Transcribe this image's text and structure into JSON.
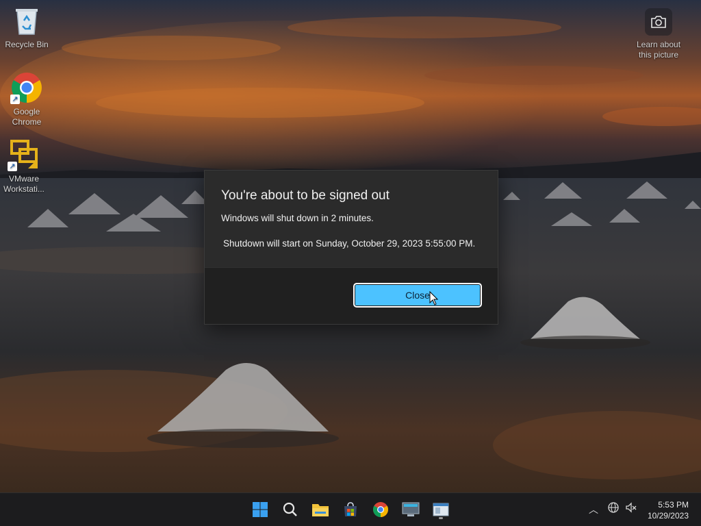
{
  "desktop": {
    "icons": [
      {
        "label": "Recycle Bin"
      },
      {
        "label": "Google Chrome"
      },
      {
        "label": "VMware Workstati..."
      }
    ],
    "learn_picture": {
      "label": "Learn about this picture",
      "icon": "camera-icon"
    }
  },
  "dialog": {
    "title": "You're about to be signed out",
    "message": "Windows will shut down in 2 minutes.",
    "detail": "Shutdown will start on Sunday, October 29, 2023 5:55:00 PM.",
    "close_label": "Close",
    "accent_color": "#4cc2ff"
  },
  "taskbar": {
    "apps": [
      "start-icon",
      "search-icon",
      "file-explorer-icon",
      "store-icon",
      "chrome-icon",
      "vmware-icon",
      "window-app-icon"
    ],
    "clock": {
      "time": "5:53 PM",
      "date": "10/29/2023"
    }
  }
}
